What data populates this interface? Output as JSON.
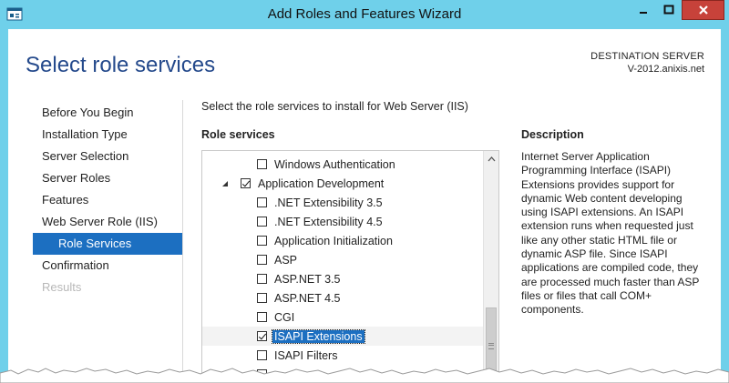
{
  "window": {
    "title": "Add Roles and Features Wizard",
    "controls": [
      "minimize",
      "maximize",
      "close"
    ]
  },
  "header": {
    "page_title": "Select role services",
    "destination_label": "DESTINATION SERVER",
    "destination_server": "V-2012.anixis.net"
  },
  "nav": {
    "items": [
      {
        "label": "Before You Begin",
        "state": "normal"
      },
      {
        "label": "Installation Type",
        "state": "normal"
      },
      {
        "label": "Server Selection",
        "state": "normal"
      },
      {
        "label": "Server Roles",
        "state": "normal"
      },
      {
        "label": "Features",
        "state": "normal"
      },
      {
        "label": "Web Server Role (IIS)",
        "state": "normal"
      },
      {
        "label": "Role Services",
        "state": "active"
      },
      {
        "label": "Confirmation",
        "state": "normal"
      },
      {
        "label": "Results",
        "state": "disabled"
      }
    ]
  },
  "main": {
    "instruction": "Select the role services to install for Web Server (IIS)",
    "role_services_heading": "Role services",
    "tree": [
      {
        "label": "Windows Authentication",
        "checked": false
      },
      {
        "label": "Application Development",
        "checked": true
      },
      {
        "label": ".NET Extensibility 3.5",
        "checked": false
      },
      {
        "label": ".NET Extensibility 4.5",
        "checked": false
      },
      {
        "label": "Application Initialization",
        "checked": false
      },
      {
        "label": "ASP",
        "checked": false
      },
      {
        "label": "ASP.NET 3.5",
        "checked": false
      },
      {
        "label": "ASP.NET 4.5",
        "checked": false
      },
      {
        "label": "CGI",
        "checked": false
      },
      {
        "label": "ISAPI Extensions",
        "checked": true,
        "selected": true
      },
      {
        "label": "ISAPI Filters",
        "checked": false
      }
    ]
  },
  "description": {
    "heading": "Description",
    "text": "Internet Server Application Programming Interface (ISAPI) Extensions provides support for dynamic Web content developing using ISAPI extensions. An ISAPI extension runs when requested just like any other static HTML file or dynamic ASP file. Since ISAPI applications are compiled code, they are processed much faster than ASP files or files that call COM+ components."
  },
  "colors": {
    "titlebar": "#6fd0ea",
    "accent": "#1c6fc1",
    "close_button": "#c7423a",
    "page_title": "#254a8c"
  }
}
